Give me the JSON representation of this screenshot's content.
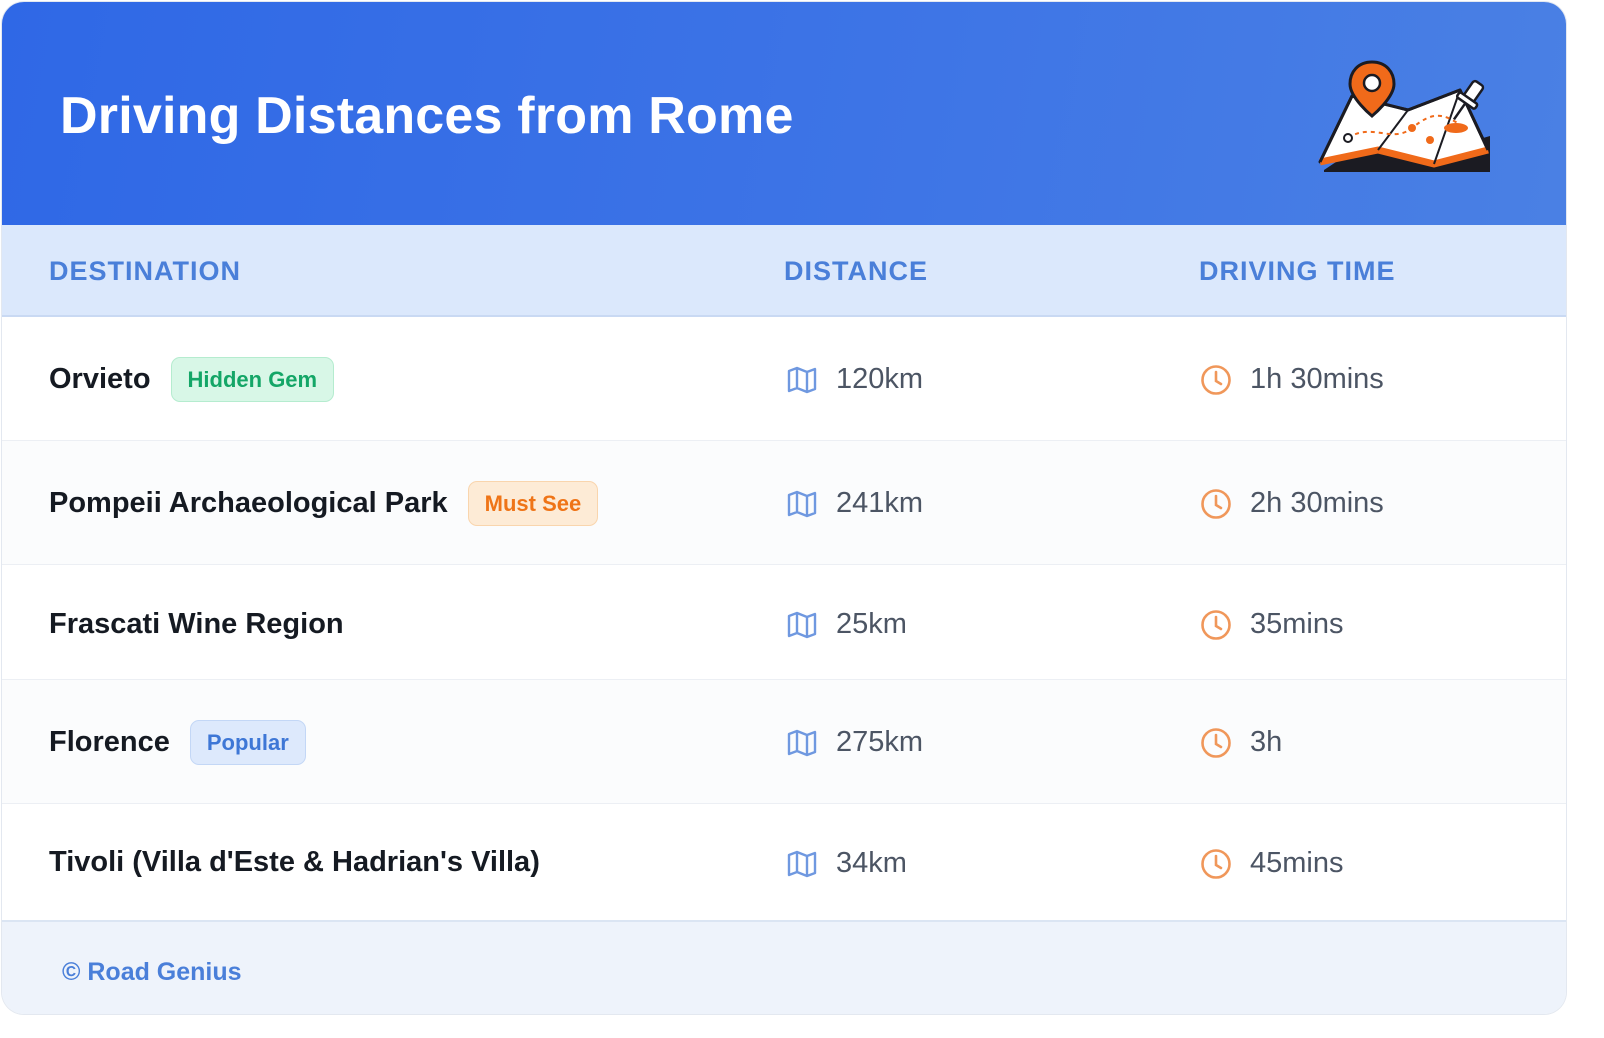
{
  "header": {
    "title": "Driving Distances from Rome",
    "illustration_icon": "map-pin-illustration"
  },
  "columns": {
    "destination": "DESTINATION",
    "distance": "DISTANCE",
    "driving_time": "DRIVING TIME"
  },
  "rows": [
    {
      "destination": "Orvieto",
      "badge": "Hidden Gem",
      "badge_style": "green",
      "distance": "120km",
      "time": "1h 30mins"
    },
    {
      "destination": "Pompeii Archaeological Park",
      "badge": "Must See",
      "badge_style": "orange",
      "distance": "241km",
      "time": "2h 30mins"
    },
    {
      "destination": "Frascati Wine Region",
      "badge": "",
      "badge_style": "",
      "distance": "25km",
      "time": "35mins"
    },
    {
      "destination": "Florence",
      "badge": "Popular",
      "badge_style": "blue",
      "distance": "275km",
      "time": "3h"
    },
    {
      "destination": "Tivoli (Villa d'Este & Hadrian's Villa)",
      "badge": "",
      "badge_style": "",
      "distance": "34km",
      "time": "45mins"
    }
  ],
  "footer": {
    "credit": "© Road Genius"
  },
  "colors": {
    "header_blue": "#2f68e6",
    "accent_orange": "#ef7417",
    "map_icon_blue": "#6f98e0",
    "clock_orange": "#f0975a"
  }
}
